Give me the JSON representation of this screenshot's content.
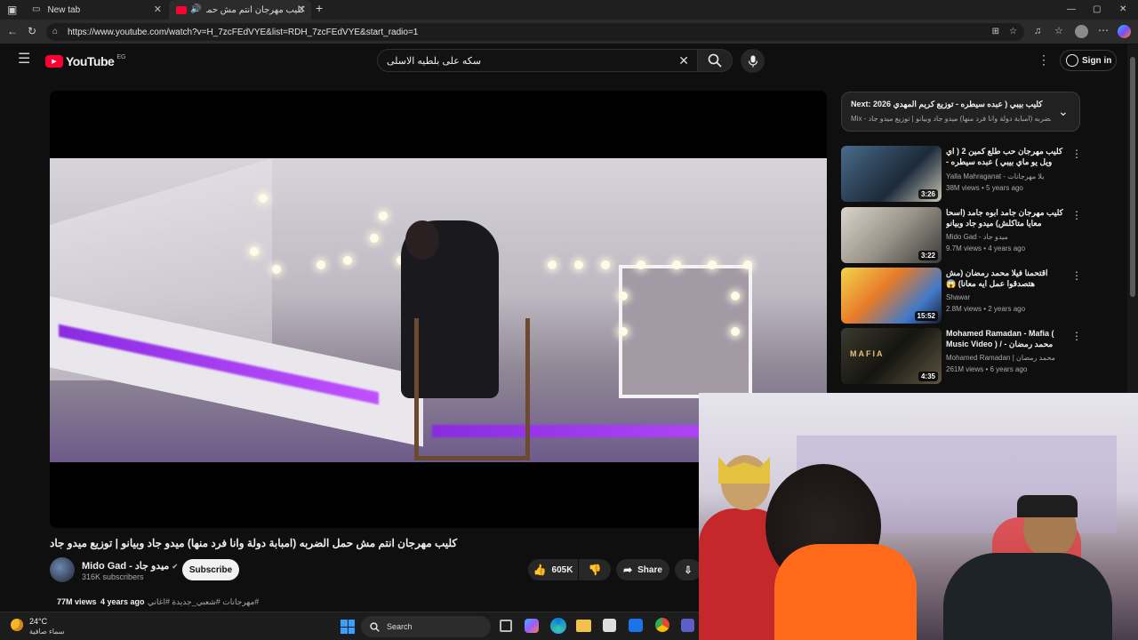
{
  "browser": {
    "tabs": [
      {
        "label": "New tab"
      },
      {
        "label": "كليب مهرجان انتم مش حمل ال"
      }
    ],
    "new_tab_symbol": "+",
    "url": "https://www.youtube.com/watch?v=H_7zcFEdVYE&list=RDH_7zcFEdVYE&start_radio=1",
    "window_controls": [
      "—",
      "▢",
      "✕"
    ]
  },
  "youtube": {
    "logo_text": "YouTube",
    "region": "EG",
    "search_query": "سكه على بلطيه الاسلى",
    "sign_in_label": "Sign in",
    "video": {
      "title": "كليب مهرجان انتم مش حمل الضربه (امبابة دولة وانا فرد منها) ميدو جاد وبيانو | توزيع ميدو جاد",
      "channel": "Mido Gad - ميدو جاد",
      "subscribers": "316K subscribers",
      "subscribe_label": "Subscribe",
      "likes": "605K",
      "share_label": "Share",
      "views": "77M views",
      "age": "4 years ago",
      "hashtags": "#مهرجانات #شعبي_جديدة #اغاني"
    },
    "next_box": {
      "prefix": "Next:",
      "title": "2026 كليب بيبي ( عبده سيطره - توزيع كريم المهدي",
      "subtitle": "Mix - كليب مهرجان انتم مش حمل الضربه (امبابة دولة وانا فرد منها) ميدو جاد وبيانو | توزيع ميدو جاد"
    },
    "recommendations": [
      {
        "title": "كليب مهرجان حب طلع كمين 2 ( اي ويل يو ماي بيبي ) عبده سيطره - توزيع كريم",
        "channel": "Yalla Mahraganat - يلا مهرجانات",
        "stats": "38M views • 5 years ago",
        "duration": "3:26"
      },
      {
        "title": "كليب مهرجان جامد ابوه جامد (اسحا معايا متاكلش) ميدو جاد وبيانو وسيطرة توزيع",
        "channel": "Mido Gad - ميدو جاد",
        "stats": "9.7M views • 4 years ago",
        "duration": "3:22"
      },
      {
        "title": "اقتحمنا فيلا محمد رمضان (مش هتصدقوا عمل ايه معانا) 😱",
        "channel": "Shawar",
        "stats": "2.8M views • 2 years ago",
        "duration": "15:52"
      },
      {
        "title": "Mohamed Ramadan - Mafia ( Music Video ) / محمد رمضان - مافيا",
        "channel": "Mohamed Ramadan | محمد رمضان",
        "stats": "261M views • 6 years ago",
        "duration": "4:35"
      }
    ]
  },
  "taskbar": {
    "weather_temp": "24°C",
    "weather_desc": "سماء صافية",
    "search_label": "Search"
  },
  "colors": {
    "bg": "#0f0f0f",
    "yt_red": "#ff0033",
    "link_blue": "#3ea6ff"
  }
}
